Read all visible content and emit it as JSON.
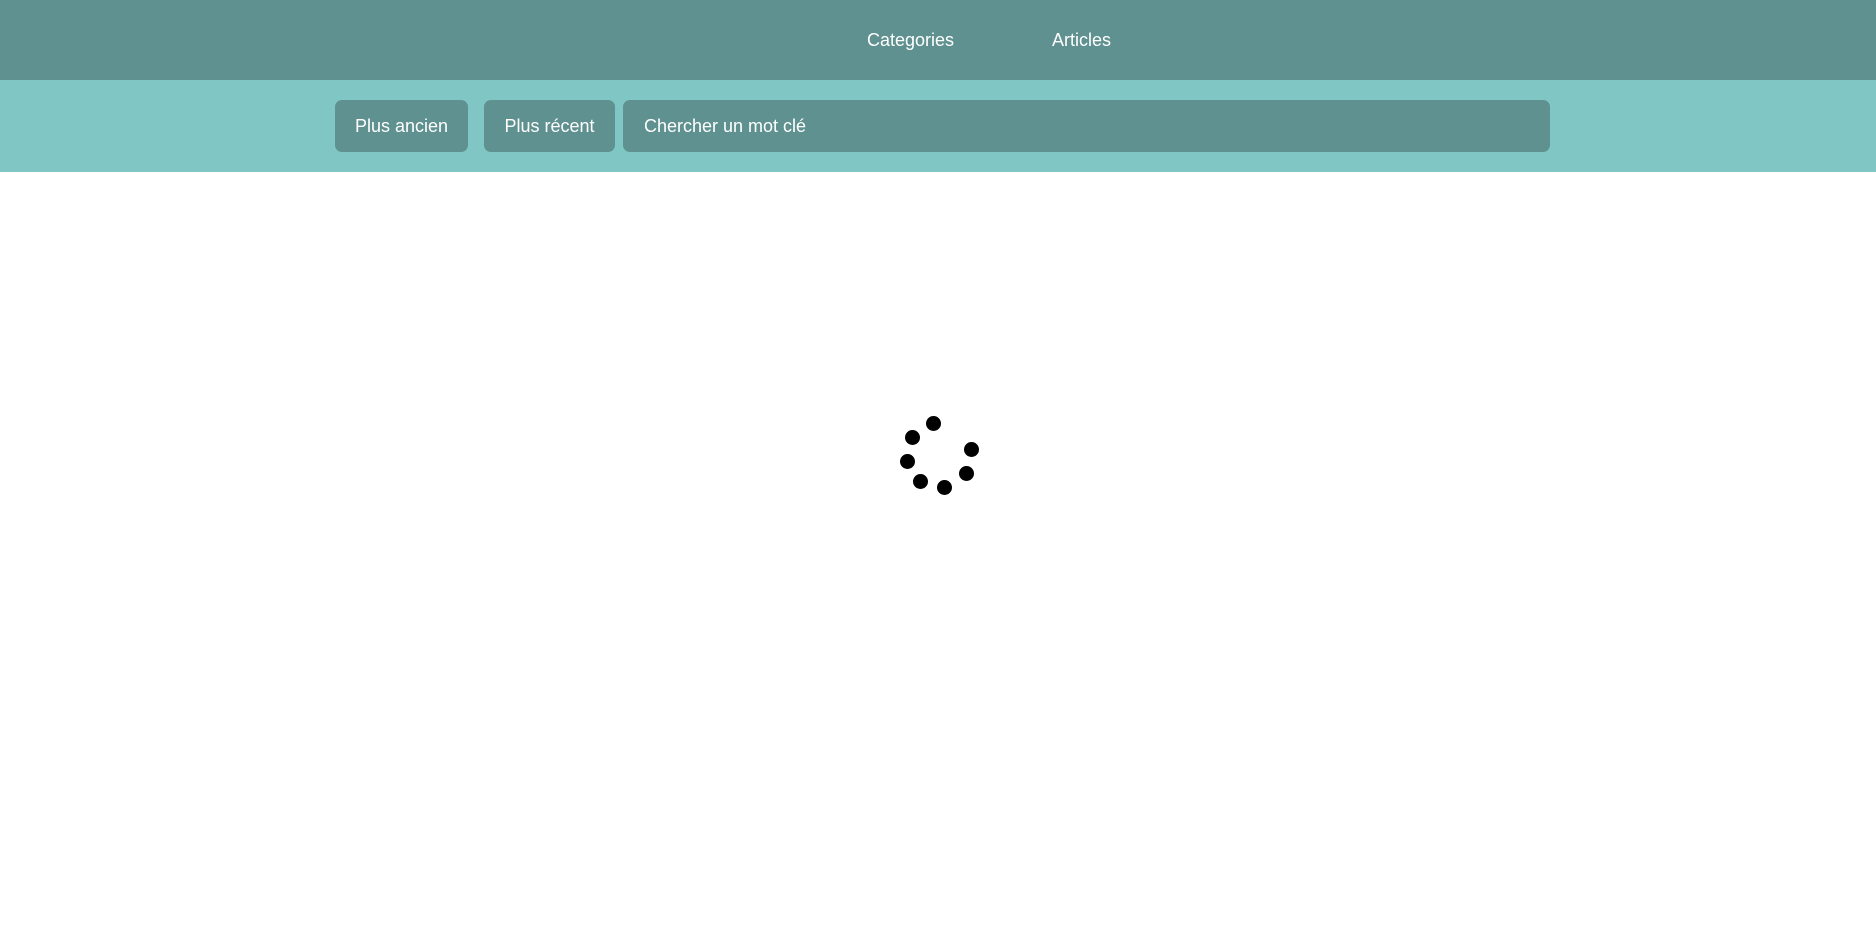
{
  "nav": {
    "categories_label": "Categories",
    "articles_label": "Articles"
  },
  "filters": {
    "oldest_label": "Plus ancien",
    "newest_label": "Plus récent",
    "search_placeholder": "Chercher un mot clé",
    "search_value": ""
  },
  "colors": {
    "nav_bg": "#5e918f",
    "filter_bar_bg": "#7fc6c5",
    "button_bg": "#5e918f",
    "text": "#ffffff",
    "spinner": "#000000"
  },
  "loading": {
    "icon": "loading-spinner-icon",
    "dot_count": 7
  }
}
